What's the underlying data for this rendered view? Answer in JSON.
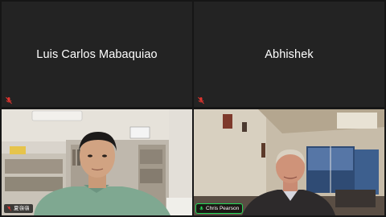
{
  "participants": [
    {
      "name": "Luis Carlos Mabaquiao",
      "video": false,
      "muted": true
    },
    {
      "name": "Abhishek",
      "video": false,
      "muted": true
    },
    {
      "name": "夏嶺嶺",
      "video": true,
      "muted": true
    },
    {
      "name": "Chris Pearson",
      "video": true,
      "muted": false,
      "speaking": true
    }
  ],
  "colors": {
    "tile_bg": "#232323",
    "muted_red": "#e0342f",
    "speaker_outline": "#23d959"
  }
}
